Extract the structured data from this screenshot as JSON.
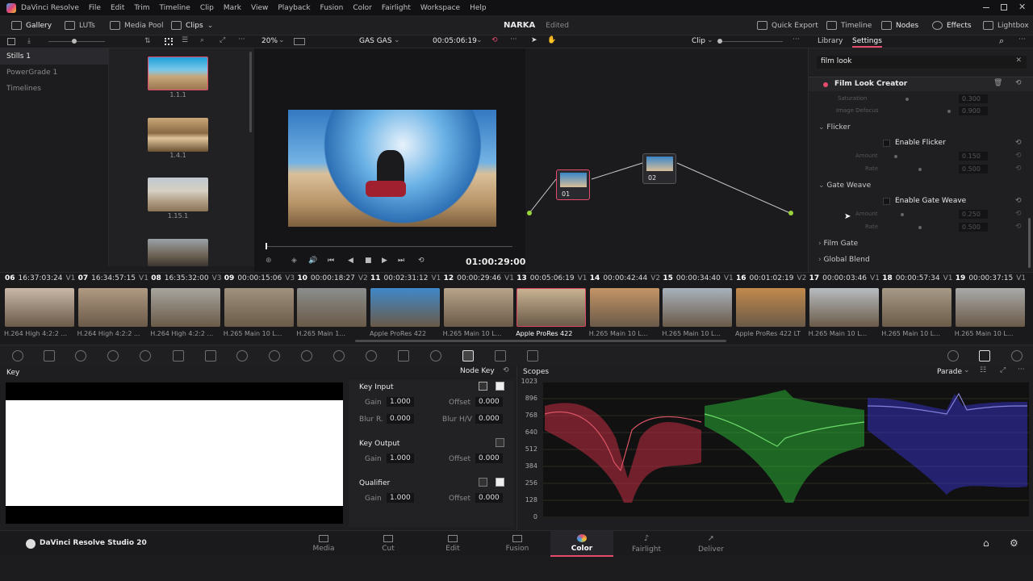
{
  "menu": {
    "app": "DaVinci Resolve",
    "items": [
      "File",
      "Edit",
      "Trim",
      "Timeline",
      "Clip",
      "Mark",
      "View",
      "Playback",
      "Fusion",
      "Color",
      "Fairlight",
      "Workspace",
      "Help"
    ]
  },
  "toolbar": {
    "gallery": "Gallery",
    "luts": "LUTs",
    "media_pool": "Media Pool",
    "clips": "Clips",
    "project_name": "NARKA",
    "project_status": "Edited",
    "quick_export": "Quick Export",
    "timeline": "Timeline",
    "nodes": "Nodes",
    "effects": "Effects",
    "lightbox": "Lightbox"
  },
  "viewer_bar": {
    "zoom": "20%",
    "timeline_name": "GAS GAS",
    "timecode": "00:05:06:19",
    "mode": "Clip"
  },
  "gallery": {
    "items": [
      "Stills 1",
      "PowerGrade 1",
      "Timelines"
    ],
    "stills": [
      "1.1.1",
      "1.4.1",
      "1.15.1"
    ]
  },
  "viewer": {
    "timecode": "01:00:29:00"
  },
  "nodes": [
    {
      "label": "01"
    },
    {
      "label": "02"
    }
  ],
  "settings": {
    "tabs": [
      "Library",
      "Settings"
    ],
    "search_value": "film look",
    "effect_title": "Film Look Creator",
    "rows_top": [
      {
        "label": "Saturation",
        "value": "0.300"
      },
      {
        "label": "Image Defocus",
        "value": "0.900"
      }
    ],
    "sections": [
      {
        "title": "Flicker",
        "toggle": "Enable Flicker",
        "params": [
          {
            "label": "Amount",
            "value": "0.150"
          },
          {
            "label": "Rate",
            "value": "0.500"
          }
        ]
      },
      {
        "title": "Gate Weave",
        "toggle": "Enable Gate Weave",
        "params": [
          {
            "label": "Amount",
            "value": "0.250"
          },
          {
            "label": "Rate",
            "value": "0.500"
          }
        ]
      }
    ],
    "collapsed": [
      "Film Gate",
      "Global Blend"
    ]
  },
  "timeline_clips": [
    {
      "num": "06",
      "tc": "16:37:03:24",
      "track": "V1",
      "codec": "H.264 High 4:2:2 ...",
      "color": "#c9b8a8"
    },
    {
      "num": "07",
      "tc": "16:34:57:15",
      "track": "V1",
      "codec": "H.264 High 4:2:2 ...",
      "color": "#b09a82"
    },
    {
      "num": "08",
      "tc": "16:35:32:00",
      "track": "V3",
      "codec": "H.264 High 4:2:2 ...",
      "color": "#a7a49e"
    },
    {
      "num": "09",
      "tc": "00:00:15:06",
      "track": "V3",
      "codec": "H.265 Main 10 L...",
      "color": "#a0907e"
    },
    {
      "num": "10",
      "tc": "00:00:18:27",
      "track": "V2",
      "codec": "H.265 Main 1...",
      "color": "#8a8e8c"
    },
    {
      "num": "11",
      "tc": "00:02:31:12",
      "track": "V1",
      "codec": "Apple ProRes 422",
      "color": "#3f88c9"
    },
    {
      "num": "12",
      "tc": "00:00:29:46",
      "track": "V1",
      "codec": "H.265 Main 10 L...",
      "color": "#b8a48a"
    },
    {
      "num": "13",
      "tc": "00:05:06:19",
      "track": "V1",
      "codec": "Apple ProRes 422",
      "color": "#c8b292"
    },
    {
      "num": "14",
      "tc": "00:00:42:44",
      "track": "V2",
      "codec": "H.265 Main 10 L...",
      "color": "#c49466"
    },
    {
      "num": "15",
      "tc": "00:00:34:40",
      "track": "V1",
      "codec": "H.265 Main 10 L...",
      "color": "#a8b2bc"
    },
    {
      "num": "16",
      "tc": "00:01:02:19",
      "track": "V2",
      "codec": "Apple ProRes 422 LT",
      "color": "#c28a4c"
    },
    {
      "num": "17",
      "tc": "00:00:03:46",
      "track": "V1",
      "codec": "H.265 Main 10 L...",
      "color": "#b8bcc0"
    },
    {
      "num": "18",
      "tc": "00:00:57:34",
      "track": "V1",
      "codec": "H.265 Main 10 L...",
      "color": "#a89a88"
    },
    {
      "num": "19",
      "tc": "00:00:37:15",
      "track": "V1",
      "codec": "H.265 Main 10 L...",
      "color": "#aaaaaa"
    }
  ],
  "key": {
    "title": "Key",
    "mode": "Node Key",
    "key_input": "Key Input",
    "gain_label": "Gain",
    "gain": "1.000",
    "offset_label": "Offset",
    "offset": "0.000",
    "blur_r_label": "Blur R.",
    "blur_r": "0.000",
    "blur_hv_label": "Blur H/V",
    "blur_hv": "0.000",
    "key_output": "Key Output",
    "out_gain": "1.000",
    "out_offset": "0.000",
    "qualifier": "Qualifier",
    "q_gain": "1.000",
    "q_offset": "0.000"
  },
  "scopes": {
    "title": "Scopes",
    "mode": "Parade",
    "ticks": [
      "1023",
      "896",
      "768",
      "640",
      "512",
      "384",
      "256",
      "128",
      "0"
    ]
  },
  "pagebar": {
    "product": "DaVinci Resolve Studio 20",
    "pages": [
      "Media",
      "Cut",
      "Edit",
      "Fusion",
      "Color",
      "Fairlight",
      "Deliver"
    ],
    "active": "Color"
  },
  "colors": {
    "accent": "#e64b6e",
    "active_clip": "#d9455f",
    "node_wire": "#c8c8c8"
  }
}
